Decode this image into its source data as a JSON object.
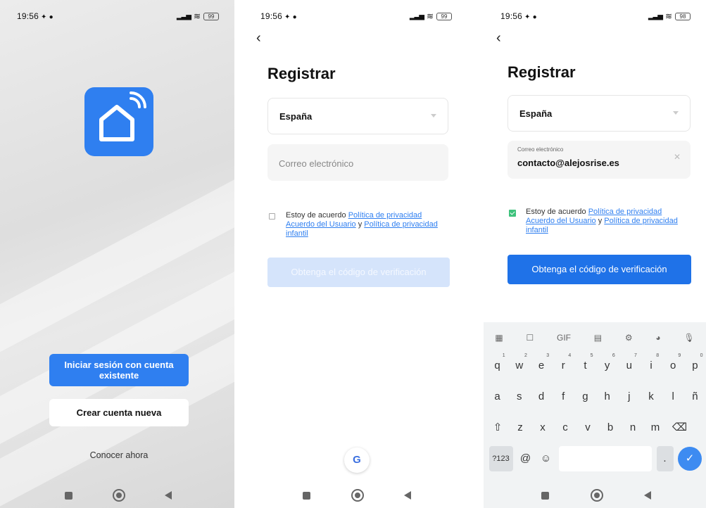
{
  "status": {
    "time": "19:56",
    "battery_1": "99",
    "battery_2": "99",
    "battery_3": "98"
  },
  "screen1": {
    "login_button": "Iniciar sesión con cuenta existente",
    "create_button": "Crear cuenta nueva",
    "discover_link": "Conocer ahora",
    "logo_color": "#2f7ff0"
  },
  "screen2": {
    "title": "Registrar",
    "country": "España",
    "email_placeholder": "Correo electrónico",
    "agree_prefix": "Estoy de acuerdo",
    "privacy_link": "Política de privacidad",
    "user_agreement_link": "Acuerdo del Usuario",
    "and": "y",
    "child_privacy_link": "Política de privacidad infantil",
    "verify_button": "Obtenga el código de verificación",
    "google_label": "G"
  },
  "screen3": {
    "title": "Registrar",
    "country": "España",
    "email_label": "Correo electrónico",
    "email_value": "contacto@alejosrise.es",
    "agree_prefix": "Estoy de acuerdo",
    "privacy_link": "Política de privacidad",
    "user_agreement_link": "Acuerdo del Usuario",
    "and": "y",
    "child_privacy_link": "Política de privacidad infantil",
    "verify_button": "Obtenga el código de verificación",
    "keyboard": {
      "gif": "GIF",
      "row1": [
        "q",
        "w",
        "e",
        "r",
        "t",
        "y",
        "u",
        "i",
        "o",
        "p"
      ],
      "row1_digits": [
        "1",
        "2",
        "3",
        "4",
        "5",
        "6",
        "7",
        "8",
        "9",
        "0"
      ],
      "row2": [
        "a",
        "s",
        "d",
        "f",
        "g",
        "h",
        "j",
        "k",
        "l",
        "ñ"
      ],
      "row3": [
        "z",
        "x",
        "c",
        "v",
        "b",
        "n",
        "m"
      ],
      "symbols_key": "?123",
      "at_key": "@",
      "period_key": "."
    }
  }
}
